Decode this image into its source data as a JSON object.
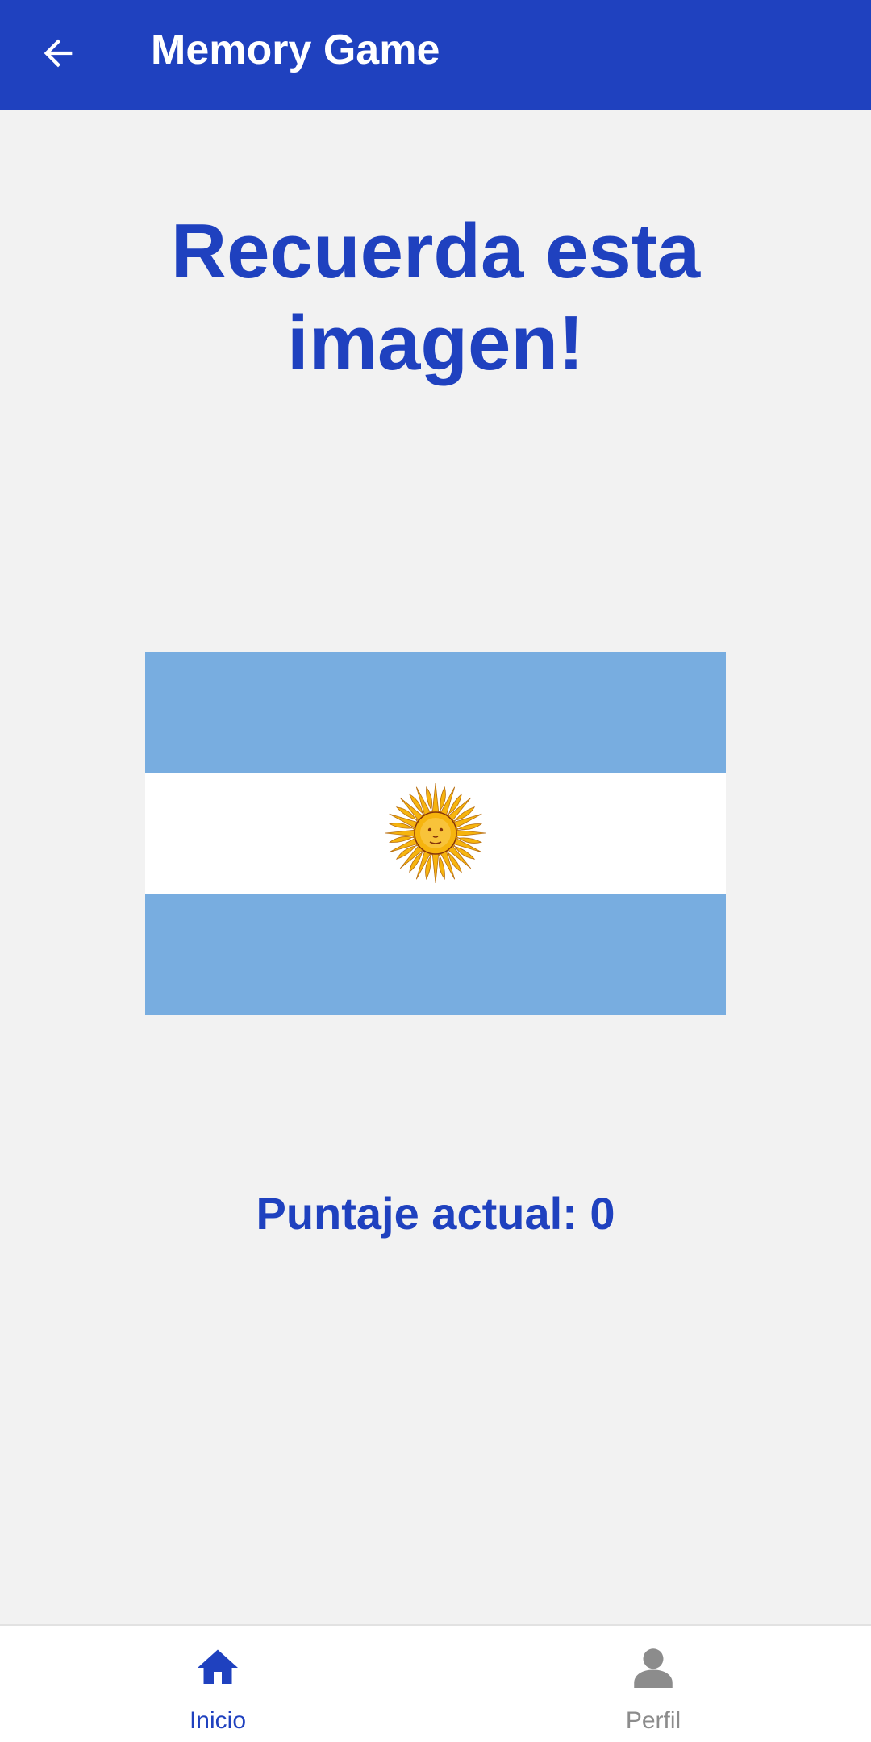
{
  "app_bar": {
    "title": "Memory Game",
    "back_icon": "arrow-left-icon",
    "background": "#1f41bf",
    "foreground": "#ffffff"
  },
  "main": {
    "headline": "Recuerda esta imagen!",
    "image": {
      "subject": "argentina-flag",
      "stripe_color": "#78ade0",
      "center_color": "#ffffff",
      "emblem": "sun-of-may-icon",
      "emblem_color": "#f2a41c"
    },
    "score_text": "Puntaje actual: 0",
    "accent": "#1f41bf",
    "background": "#f2f2f2"
  },
  "bottom_nav": {
    "items": [
      {
        "label": "Inicio",
        "icon": "home-icon",
        "active": true,
        "color": "#1f41bf"
      },
      {
        "label": "Perfil",
        "icon": "person-icon",
        "active": false,
        "color": "#8c8c8c"
      }
    ]
  }
}
